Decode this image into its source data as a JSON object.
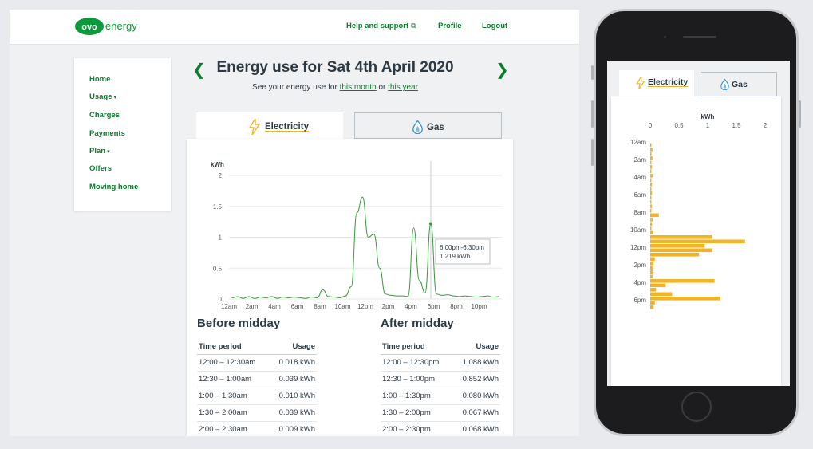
{
  "brand": {
    "logo_text": "ovo",
    "wordmark": "energy",
    "color": "#0a9a3a"
  },
  "header": {
    "links": [
      {
        "label": "Help and support",
        "external": true,
        "icon": "external-link-icon"
      },
      {
        "label": "Profile"
      },
      {
        "label": "Logout"
      }
    ]
  },
  "sidebar": {
    "items": [
      {
        "label": "Home"
      },
      {
        "label": "Usage",
        "caret": "▾"
      },
      {
        "label": "Charges"
      },
      {
        "label": "Payments"
      },
      {
        "label": "Plan",
        "caret": "▾"
      },
      {
        "label": "Offers"
      },
      {
        "label": "Moving home"
      }
    ]
  },
  "page": {
    "title": "Energy use for Sat 4th April 2020",
    "prev_icon": "chevron-left-icon",
    "next_icon": "chevron-right-icon",
    "subtitle_prefix": "See your energy use for ",
    "subtitle_link1": "this month",
    "subtitle_mid": " or ",
    "subtitle_link2": "this year"
  },
  "tabs": [
    {
      "label": "Electricity",
      "icon": "lightning-icon",
      "active": true
    },
    {
      "label": "Gas",
      "icon": "flame-drop-icon",
      "active": false
    }
  ],
  "colors": {
    "accent": "#0a7d2c",
    "line": "#3a9a3e",
    "bar": "#f0b429",
    "text": "#2c3a45"
  },
  "chart_data": [
    {
      "type": "line",
      "ylabel": "kWh",
      "ylim": [
        0,
        2
      ],
      "yticks": [
        "0",
        "0.5",
        "1",
        "1.5",
        "2"
      ],
      "xticks": [
        "12am",
        "2am",
        "4am",
        "6am",
        "8am",
        "10am",
        "12pm",
        "2pm",
        "4pm",
        "6pm",
        "8pm",
        "10pm"
      ],
      "grid": true,
      "values": [
        0.018,
        0.039,
        0.01,
        0.039,
        0.009,
        0.03,
        0.02,
        0.04,
        0.01,
        0.03,
        0.02,
        0.03,
        0.02,
        0.01,
        0.03,
        0.02,
        0.15,
        0.04,
        0.03,
        0.02,
        0.05,
        0.2,
        1.4,
        1.65,
        1.0,
        1.05,
        0.5,
        0.08,
        0.06,
        0.05,
        0.05,
        0.04,
        1.15,
        0.3,
        0.1,
        1.219,
        0.08,
        0.06,
        0.07,
        0.05,
        0.04,
        0.05,
        0.04,
        0.03,
        0.04,
        0.05,
        0.03,
        0.04
      ],
      "tooltip": {
        "time": "6:00pm-6:30pm",
        "value": "1.219 kWh",
        "index": 35
      }
    },
    {
      "type": "bar",
      "orientation": "horizontal",
      "xlabel": "kWh",
      "xlim": [
        0,
        2
      ],
      "xticks": [
        "0",
        "0.5",
        "1",
        "1.5",
        "2"
      ],
      "yticks": [
        "12am",
        "2am",
        "4am",
        "6am",
        "8am",
        "10am",
        "12pm",
        "2pm",
        "4pm",
        "6pm"
      ],
      "values": [
        0.018,
        0.039,
        0.01,
        0.039,
        0.009,
        0.03,
        0.02,
        0.04,
        0.01,
        0.03,
        0.02,
        0.03,
        0.02,
        0.01,
        0.03,
        0.02,
        0.15,
        0.04,
        0.03,
        0.02,
        0.05,
        1.08,
        1.65,
        0.95,
        1.08,
        0.85,
        0.08,
        0.06,
        0.05,
        0.05,
        0.04,
        1.12,
        0.27,
        0.1,
        0.38,
        1.219,
        0.08,
        0.06
      ]
    }
  ],
  "tables": {
    "before": {
      "title": "Before midday",
      "headers": [
        "Time period",
        "Usage"
      ],
      "rows": [
        [
          "12:00 – 12:30am",
          "0.018 kWh"
        ],
        [
          "12:30 – 1:00am",
          "0.039 kWh"
        ],
        [
          "1:00 – 1:30am",
          "0.010 kWh"
        ],
        [
          "1:30 – 2:00am",
          "0.039 kWh"
        ],
        [
          "2:00 – 2:30am",
          "0.009 kWh"
        ]
      ]
    },
    "after": {
      "title": "After midday",
      "headers": [
        "Time period",
        "Usage"
      ],
      "rows": [
        [
          "12:00 – 12:30pm",
          "1.088 kWh"
        ],
        [
          "12:30 – 1:00pm",
          "0.852 kWh"
        ],
        [
          "1:00 – 1:30pm",
          "0.080 kWh"
        ],
        [
          "1:30 – 2:00pm",
          "0.067 kWh"
        ],
        [
          "2:00 – 2:30pm",
          "0.068 kWh"
        ]
      ]
    }
  }
}
